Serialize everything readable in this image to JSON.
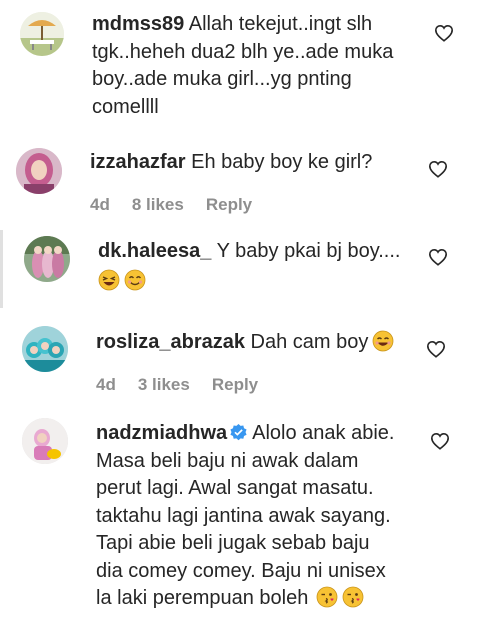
{
  "comments": [
    {
      "username": "mdmss89",
      "lines": [
        "Allah tekejut..ingt slh",
        "tgk..heheh dua2 blh ye..ade muka",
        "boy..ade muka girl...yg pnting",
        "comellll"
      ]
    },
    {
      "username": "izzahazfar",
      "text": "Eh baby boy ke girl?",
      "age": "4d",
      "likes": "8 likes",
      "reply": "Reply"
    },
    {
      "username": "dk.haleesa_",
      "text": "Y baby pkai bj boy....",
      "emojis": [
        "laughing-face",
        "smiling-face"
      ]
    },
    {
      "username": "rosliza_abrazak",
      "text": "Dah cam boy",
      "emojis": [
        "grinning-squint-face"
      ],
      "age": "4d",
      "likes": "3 likes",
      "reply": "Reply"
    },
    {
      "username": "nadzmiadhwa",
      "verified": true,
      "lines": [
        "Alolo anak abie.",
        "Masa beli baju ni awak dalam",
        "perut lagi. Awal sangat masatu.",
        "taktahu lagi jantina awak sayang.",
        "Tapi abie beli jugak sebab baju",
        "dia comey comey. Baju ni unisex",
        "la laki perempuan boleh"
      ],
      "emojis": [
        "kissing-wink-face",
        "kissing-wink-face"
      ]
    }
  ],
  "colors": {
    "text": "#262626",
    "meta": "#8e8e8e",
    "verified": "#3897f0",
    "emoji": "#f7c234"
  }
}
